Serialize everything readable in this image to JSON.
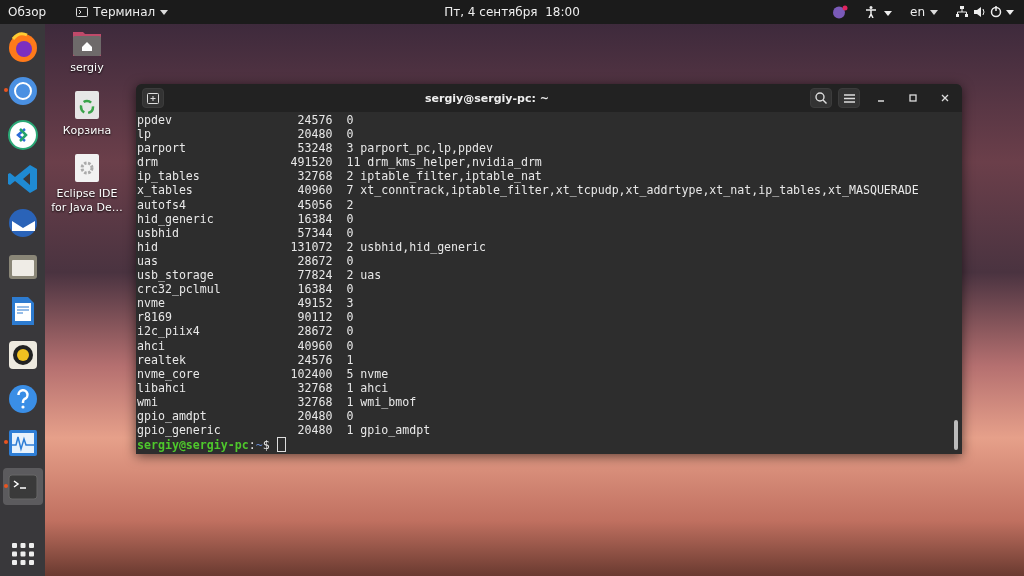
{
  "top_bar": {
    "activities": "Обзор",
    "app_menu": "Терминал",
    "clock": "Пт, 4 сентября  18:00",
    "keyboard_layout": "en"
  },
  "dock": [
    {
      "kind": "flame-globe",
      "running": false,
      "active": false
    },
    {
      "kind": "ring",
      "running": true,
      "active": false
    },
    {
      "kind": "arrows-circle",
      "running": false,
      "active": false
    },
    {
      "kind": "ribbon",
      "running": false,
      "active": false
    },
    {
      "kind": "mail",
      "running": false,
      "active": false
    },
    {
      "kind": "folder",
      "running": false,
      "active": false
    },
    {
      "kind": "document",
      "running": false,
      "active": false
    },
    {
      "kind": "speaker",
      "running": false,
      "active": false
    },
    {
      "kind": "help",
      "running": false,
      "active": false
    },
    {
      "kind": "monitor",
      "running": true,
      "active": false
    },
    {
      "kind": "terminal",
      "running": true,
      "active": true
    }
  ],
  "desktop_icons": [
    {
      "kind": "home",
      "label": "sergiy"
    },
    {
      "kind": "trash",
      "label": "Корзина"
    },
    {
      "kind": "app",
      "label": "Eclipse IDE for Java De…"
    }
  ],
  "terminal": {
    "title": "sergiy@sergiy-pc: ~",
    "rows": [
      {
        "name": "ppdev",
        "size": "24576",
        "used": "0"
      },
      {
        "name": "lp",
        "size": "20480",
        "used": "0"
      },
      {
        "name": "parport",
        "size": "53248",
        "used": "3",
        "by": "parport_pc,lp,ppdev"
      },
      {
        "name": "drm",
        "size": "491520",
        "used": "11",
        "by": "drm_kms_helper,nvidia_drm"
      },
      {
        "name": "ip_tables",
        "size": "32768",
        "used": "2",
        "by": "iptable_filter,iptable_nat"
      },
      {
        "name": "x_tables",
        "size": "40960",
        "used": "7",
        "by": "xt_conntrack,iptable_filter,xt_tcpudp,xt_addrtype,xt_nat,ip_tables,xt_MASQUERADE"
      },
      {
        "name": "autofs4",
        "size": "45056",
        "used": "2"
      },
      {
        "name": "hid_generic",
        "size": "16384",
        "used": "0"
      },
      {
        "name": "usbhid",
        "size": "57344",
        "used": "0"
      },
      {
        "name": "hid",
        "size": "131072",
        "used": "2",
        "by": "usbhid,hid_generic"
      },
      {
        "name": "uas",
        "size": "28672",
        "used": "0"
      },
      {
        "name": "usb_storage",
        "size": "77824",
        "used": "2",
        "by": "uas"
      },
      {
        "name": "crc32_pclmul",
        "size": "16384",
        "used": "0"
      },
      {
        "name": "nvme",
        "size": "49152",
        "used": "3"
      },
      {
        "name": "r8169",
        "size": "90112",
        "used": "0"
      },
      {
        "name": "i2c_piix4",
        "size": "28672",
        "used": "0"
      },
      {
        "name": "ahci",
        "size": "40960",
        "used": "0"
      },
      {
        "name": "realtek",
        "size": "24576",
        "used": "1"
      },
      {
        "name": "nvme_core",
        "size": "102400",
        "used": "5",
        "by": "nvme"
      },
      {
        "name": "libahci",
        "size": "32768",
        "used": "1",
        "by": "ahci"
      },
      {
        "name": "wmi",
        "size": "32768",
        "used": "1",
        "by": "wmi_bmof"
      },
      {
        "name": "gpio_amdpt",
        "size": "20480",
        "used": "0"
      },
      {
        "name": "gpio_generic",
        "size": "20480",
        "used": "1",
        "by": "gpio_amdpt"
      }
    ],
    "prompt": {
      "user_host": "sergiy@sergiy-pc",
      "separator": ":",
      "path": "~",
      "symbol": "$"
    }
  }
}
